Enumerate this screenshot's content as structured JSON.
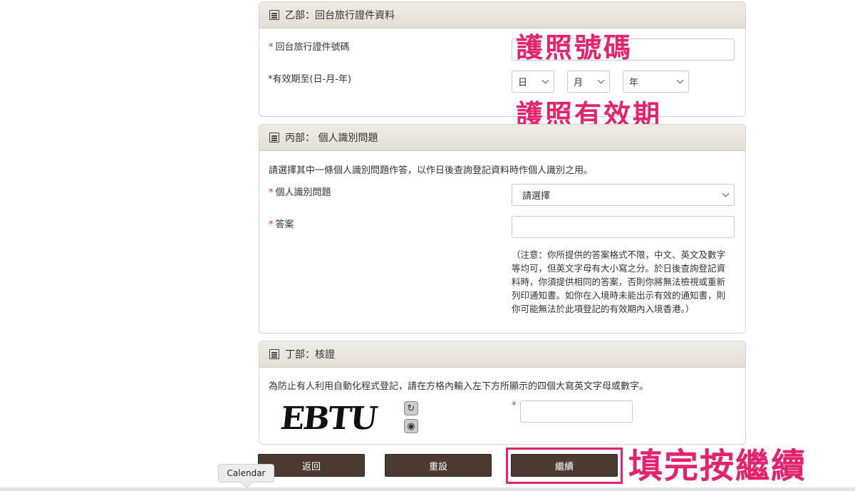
{
  "section_b": {
    "title": "乙部：回台旅行證件資料",
    "doc_number_label": "回台旅行證件號碼",
    "doc_number_value": "",
    "expiry_label": "*有效期至(日-月-年)",
    "day_select": "日",
    "month_select": "月",
    "year_select": "年"
  },
  "section_c": {
    "title": "丙部： 個人識別問題",
    "instruction": "請選擇其中一條個人識別問題作答，以作日後查詢登記資料時作個人識別之用。",
    "question_label": "個人識別問題",
    "question_select": "請選擇",
    "answer_label": "答案",
    "answer_value": "",
    "note_lines": [
      "（注意：你所提供的答案格式不限，中文、英文及數字",
      "等均可，但英文字母有大小寫之分。於日後查詢登記資",
      "料時，你須提供相同的答案，否則你將無法檢視或重新",
      "列印通知書。如你在入境時未能出示有效的通知書，則",
      "你可能無法於此項登記的有效期內入境香港。）"
    ]
  },
  "section_d": {
    "title": "丁部：核證",
    "instruction": "為防止有人利用自動化程式登記，請在方格內輸入左下方所顯示的四個大寫英文字母或數字。",
    "captcha_text": "EBTU",
    "captcha_value": "",
    "required_mark": "*"
  },
  "buttons": {
    "back": "返回",
    "reset": "重設",
    "continue": "繼續"
  },
  "annotations": {
    "passport_number": "護照號碼",
    "passport_expiry": "護照有效期",
    "fill_and_press": "填完按繼續"
  },
  "tooltip": "Calendar",
  "colors": {
    "annotation": "#e4236e",
    "button": "#4a3a30",
    "required": "#c0392b"
  },
  "icons": {
    "section_header": "document-list-icon",
    "refresh_captcha": "refresh-icon",
    "audio_captcha": "audio-icon"
  }
}
